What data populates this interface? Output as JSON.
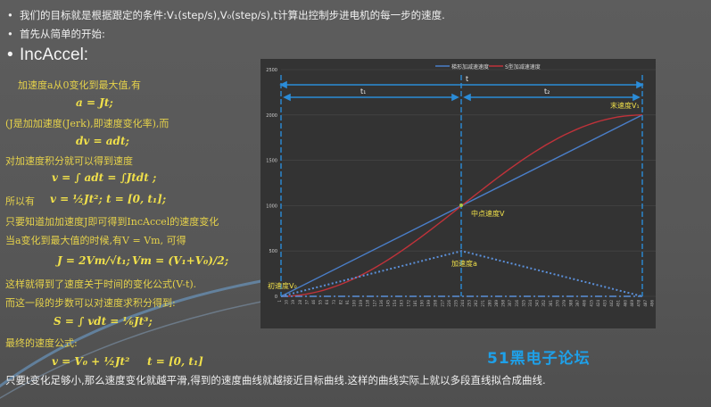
{
  "bullets": [
    "我们的目标就是根据跟定的条件:V₁(step/s),V₀(step/s),t计算出控制步进电机的每一步的速度.",
    "首先从简单的开始:"
  ],
  "section_title": "IncAccel:",
  "left_lines": [
    "加速度a从0变化到最大值,有",
    "a = Jt;",
    "(J是加加速度(Jerk),即速度变化率),而",
    "dv = adt;",
    "对加速度积分就可以得到速度",
    "v = ∫ adt = ∫Jtdt ;",
    "所以有",
    "v = ½Jt²; t = [0, t₁];",
    "只要知道加加速度J即可得到IncAccel的速度变化",
    "当a变化到最大值的时候,有V = Vm, 可得",
    "J = 2Vm/√t₁;",
    "Vm = (V₁+V₀)/2;",
    "这样就得到了速度关于时间的变化公式(V-t).",
    "而这一段的步数可以对速度求积分得到:",
    "S = ∫ vdt = ⅙Jt³;",
    "最终的速度公式:",
    "v = V₀ + ½Jt²",
    "t = [0, t₁]"
  ],
  "bottom_text": "只要t变化足够小,那么速度变化就越平滑,得到的速度曲线就越接近目标曲线.这样的曲线实际上就以多段直线拟合成曲线.",
  "watermark": "51黑电子论坛",
  "colors": {
    "linear": "#4a7ec8",
    "scurve": "#c0323a",
    "accel": "#5b8fd8",
    "annotation": "#f0e04a",
    "grid": "#4a4a4a",
    "chart_bg": "#333333"
  },
  "chart_data": {
    "type": "line",
    "title": "",
    "legend": [
      "梯形加减速速度",
      "S型加减速速度"
    ],
    "legend_position": "top",
    "ylim": [
      0,
      2500
    ],
    "yticks": [
      "0",
      "500",
      "1000",
      "1500",
      "2000",
      "2500"
    ],
    "x_range": [
      1,
      568
    ],
    "x_tick_step": 9,
    "series": [
      {
        "name": "梯形加减速速度",
        "x": [
          1,
          481
        ],
        "values": [
          0,
          2000
        ]
      },
      {
        "name": "S型加减速速度",
        "x": [
          1,
          60,
          120,
          180,
          240,
          300,
          360,
          420,
          481
        ],
        "values": [
          0,
          45,
          190,
          500,
          1000,
          1500,
          1810,
          1955,
          2000
        ]
      },
      {
        "name": "加速度a",
        "x": [
          1,
          241,
          481
        ],
        "values": [
          0,
          500,
          0
        ]
      }
    ],
    "annotations": {
      "t": "t",
      "t1": "t₁",
      "t2": "t₂",
      "start_speed": "初速度V₀",
      "mid_speed": "中点速度V",
      "end_speed": "末速度V₁",
      "accel": "加速度a"
    }
  }
}
